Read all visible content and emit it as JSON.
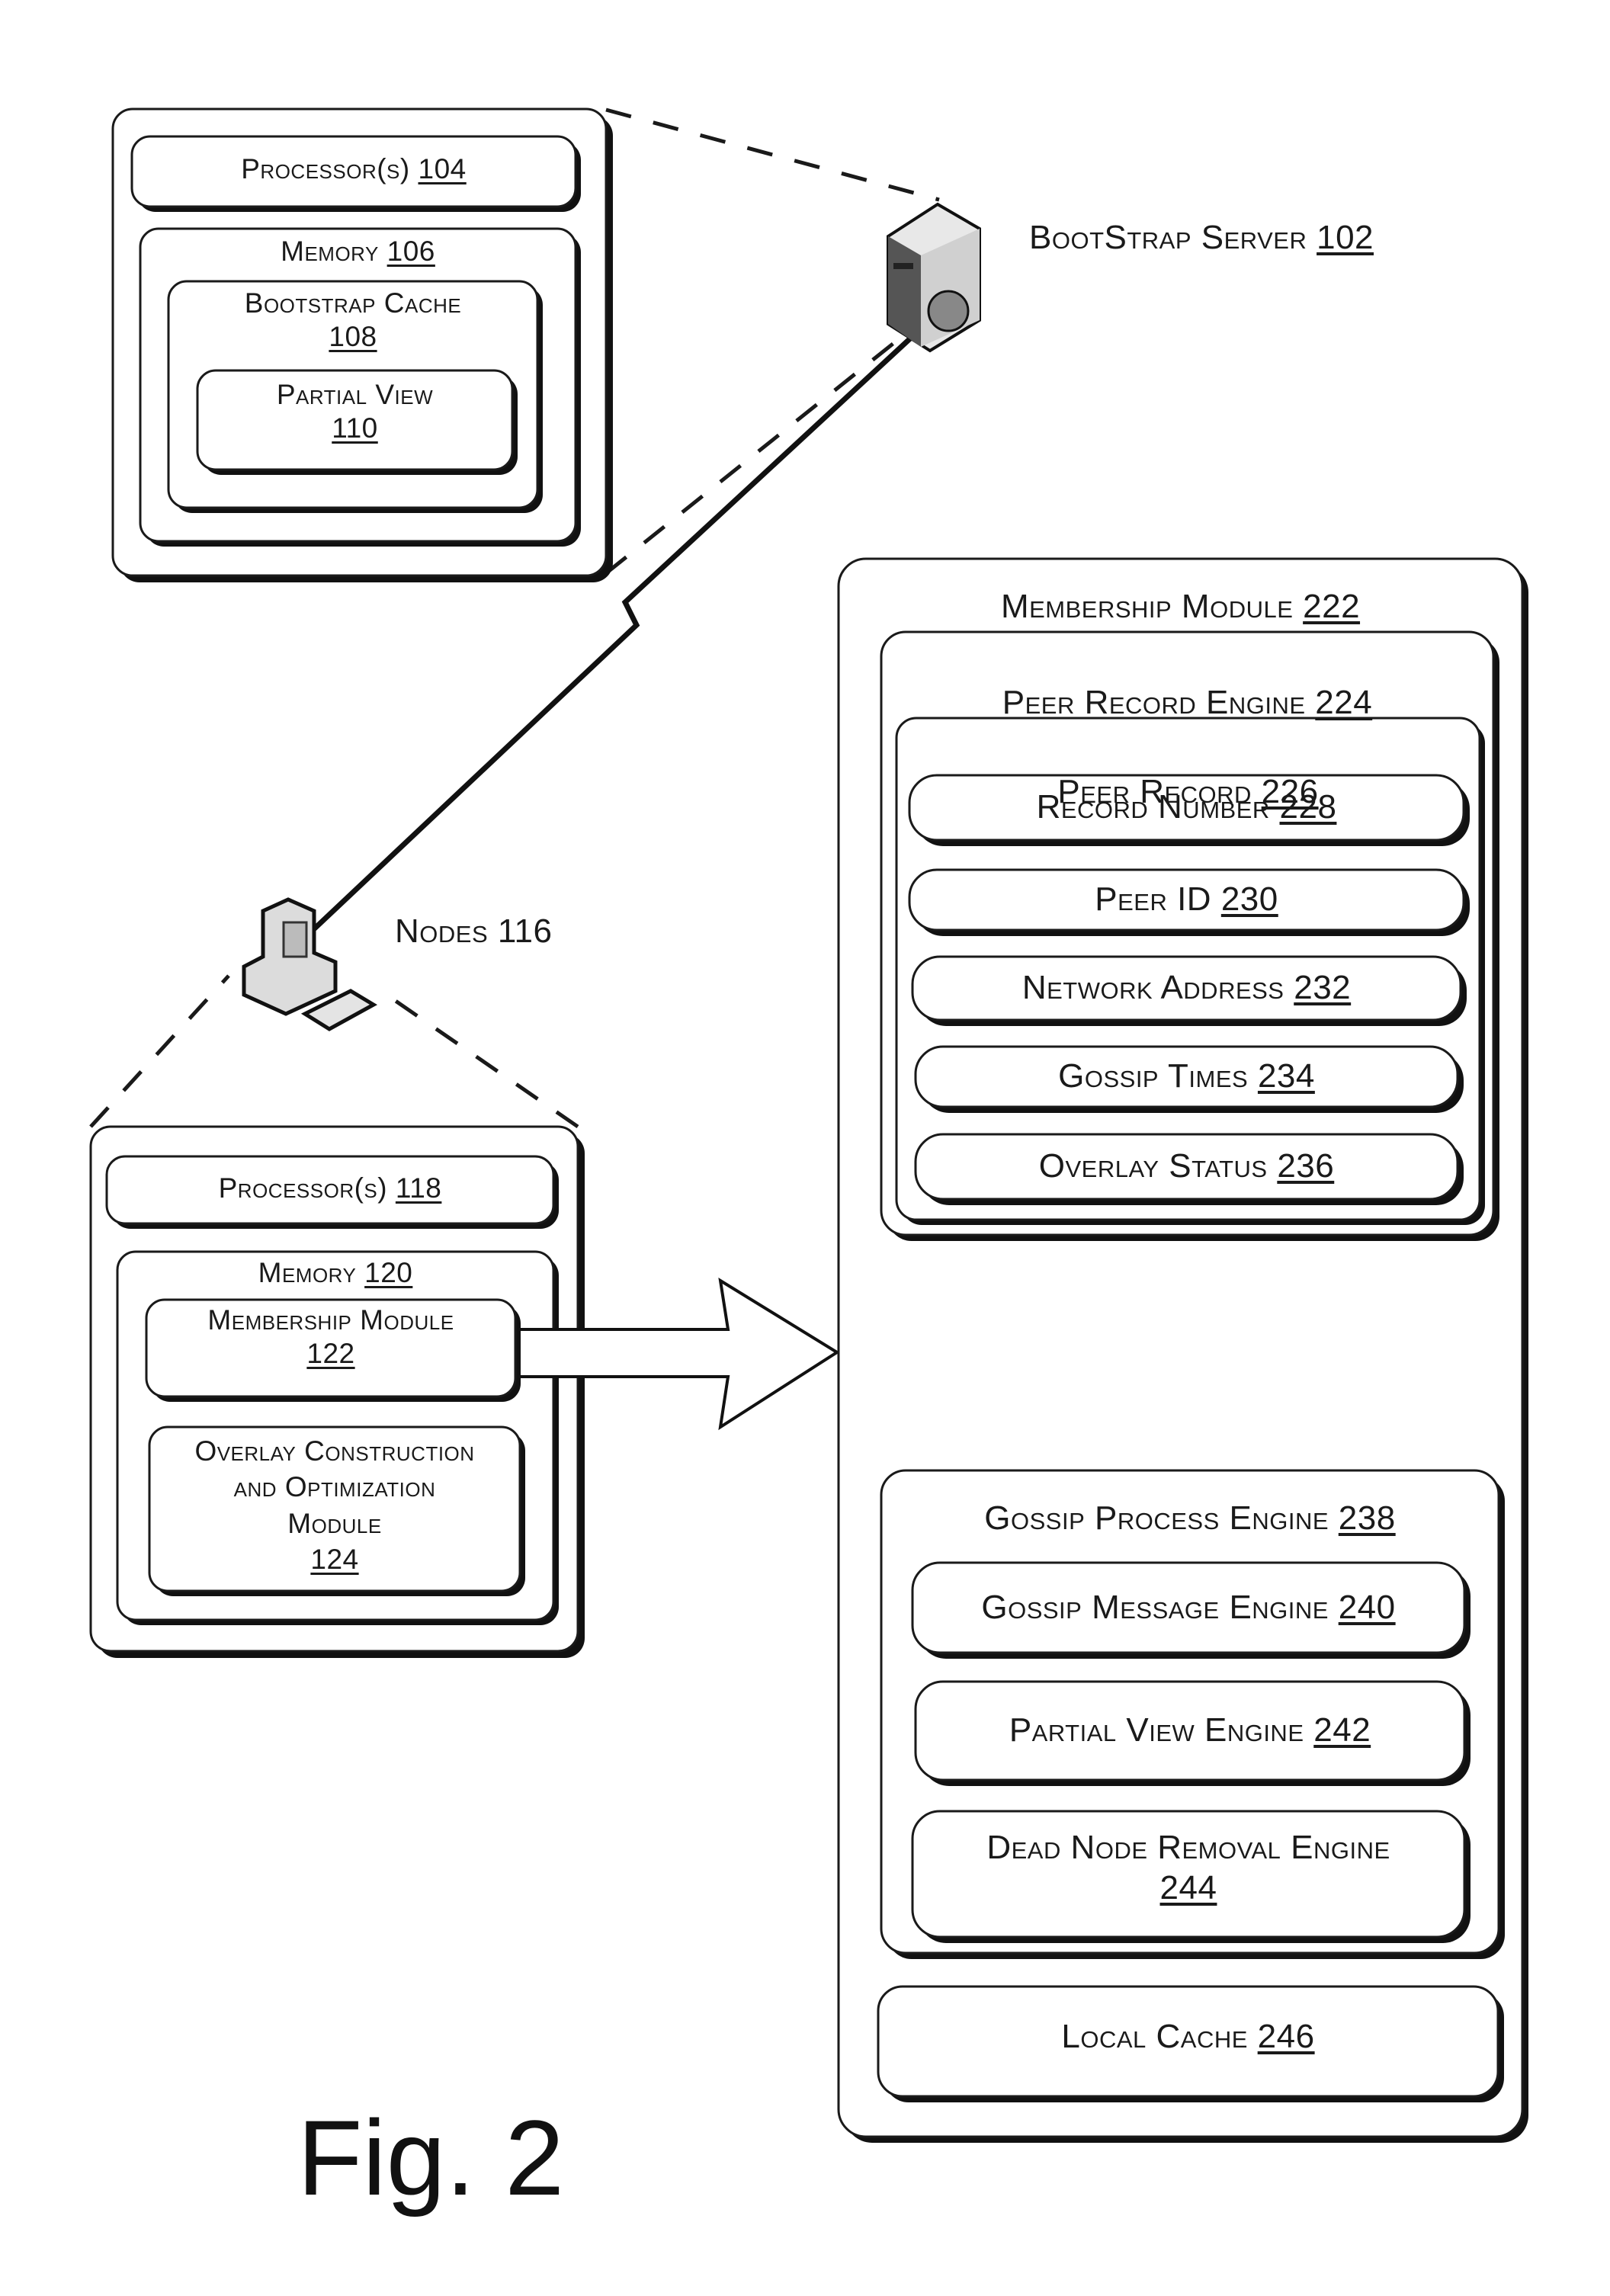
{
  "figure_label": "Fig. 2",
  "bootstrap_server": {
    "label": "BootStrap Server",
    "ref": "102",
    "icon": "server-icon",
    "components": {
      "processor": {
        "label": "Processor(s)",
        "ref": "104"
      },
      "memory": {
        "label": "Memory",
        "ref": "106"
      },
      "bootstrap_cache": {
        "label": "Bootstrap Cache",
        "ref": "108"
      },
      "partial_view": {
        "label": "Partial View",
        "ref": "110"
      }
    }
  },
  "nodes": {
    "label": "Nodes 116",
    "icon": "computer-icon",
    "components": {
      "processor": {
        "label": "Processor(s)",
        "ref": "118"
      },
      "memory": {
        "label": "Memory",
        "ref": "120"
      },
      "membership_module": {
        "label": "Membership Module",
        "ref": "122"
      },
      "overlay_module": {
        "label_line1": "Overlay Construction",
        "label_line2": "and Optimization",
        "label_line3": "Module",
        "ref": "124"
      }
    }
  },
  "connection": {
    "type": "wireless-link",
    "icon": "lightning-bolt-icon"
  },
  "membership_module_detail": {
    "label": "Membership Module",
    "ref": "222",
    "peer_record_engine": {
      "label": "Peer Record Engine",
      "ref": "224",
      "peer_record": {
        "label": "Peer Record",
        "ref": "226",
        "fields": [
          {
            "label": "Record Number",
            "ref": "228"
          },
          {
            "label": "Peer ID",
            "ref": "230"
          },
          {
            "label": "Network Address",
            "ref": "232"
          },
          {
            "label": "Gossip Times",
            "ref": "234"
          },
          {
            "label": "Overlay Status",
            "ref": "236"
          }
        ]
      }
    },
    "gossip_process_engine": {
      "label": "Gossip Process Engine",
      "ref": "238",
      "engines": [
        {
          "label": "Gossip Message Engine",
          "ref": "240"
        },
        {
          "label": "Partial View Engine",
          "ref": "242"
        },
        {
          "label": "Dead Node Removal Engine",
          "ref": "244"
        }
      ]
    },
    "local_cache": {
      "label": "Local Cache",
      "ref": "246"
    }
  }
}
